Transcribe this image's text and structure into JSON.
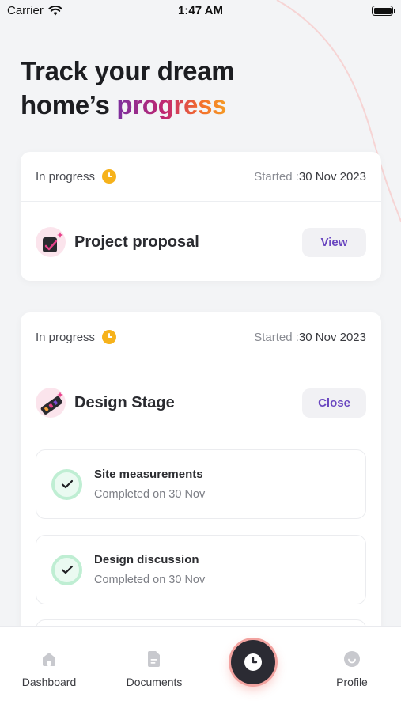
{
  "status_bar": {
    "carrier": "Carrier",
    "time": "1:47 AM"
  },
  "headline": {
    "line1": "Track your dream",
    "line2_prefix": "home’s ",
    "line2_highlight": "progress"
  },
  "cards": [
    {
      "status": "In progress",
      "started_prefix": "Started :",
      "started_date": "30 Nov 2023",
      "stage_title": "Project proposal",
      "action_label": "View"
    },
    {
      "status": "In progress",
      "started_prefix": "Started :",
      "started_date": "30 Nov 2023",
      "stage_title": "Design Stage",
      "action_label": "Close",
      "tasks": [
        {
          "title": "Site measurements",
          "subtitle": "Completed on 30 Nov"
        },
        {
          "title": "Design discussion",
          "subtitle": "Completed on 30 Nov"
        }
      ]
    }
  ],
  "bottom_nav": {
    "items": [
      {
        "label": "Dashboard",
        "icon": "home-icon"
      },
      {
        "label": "Documents",
        "icon": "document-icon"
      },
      {
        "label": "Profile",
        "icon": "profile-icon"
      }
    ],
    "center_button_icon": "clock-icon"
  },
  "colors": {
    "accent_purple": "#6a47c0",
    "status_orange": "#f6b21b",
    "check_green": "#bfeed3",
    "gradient": [
      "#7b2fa0",
      "#c2276f",
      "#f36b2c",
      "#f59b25"
    ]
  }
}
